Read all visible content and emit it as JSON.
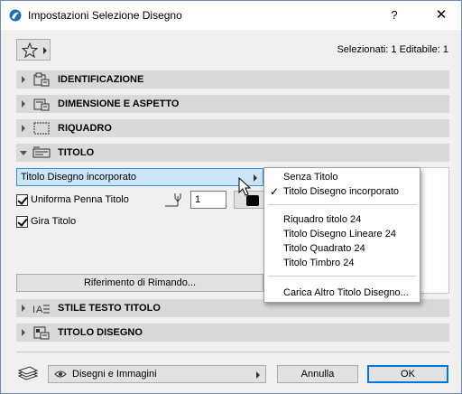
{
  "window": {
    "title": "Impostazioni Selezione Disegno",
    "help": "?",
    "close": "✕"
  },
  "toolbar": {
    "selection_info": "Selezionati: 1 Editabile: 1"
  },
  "sections": {
    "identificazione": "IDENTIFICAZIONE",
    "dimensione": "DIMENSIONE E ASPETTO",
    "riquadro": "RIQUADRO",
    "titolo": "TITOLO",
    "stile_testo": "STILE TESTO TITOLO",
    "titolo_disegno": "TITOLO DISEGNO"
  },
  "titolo_panel": {
    "title_type": "Titolo Disegno incorporato",
    "uniforma_penna": "Uniforma Penna Titolo",
    "pen_value": "1",
    "gira_titolo": "Gira Titolo",
    "riferimento_button": "Riferimento di Rimando..."
  },
  "dropdown": {
    "items": [
      "Senza Titolo",
      "Titolo Disegno incorporato",
      "Riquadro titolo 24",
      "Titolo Disegno Lineare 24",
      "Titolo Quadrato 24",
      "Titolo Timbro 24",
      "Carica Altro Titolo Disegno..."
    ],
    "selected_index": 1
  },
  "footer": {
    "view_select": "Disegni e Immagini",
    "cancel": "Annulla",
    "ok": "OK"
  }
}
